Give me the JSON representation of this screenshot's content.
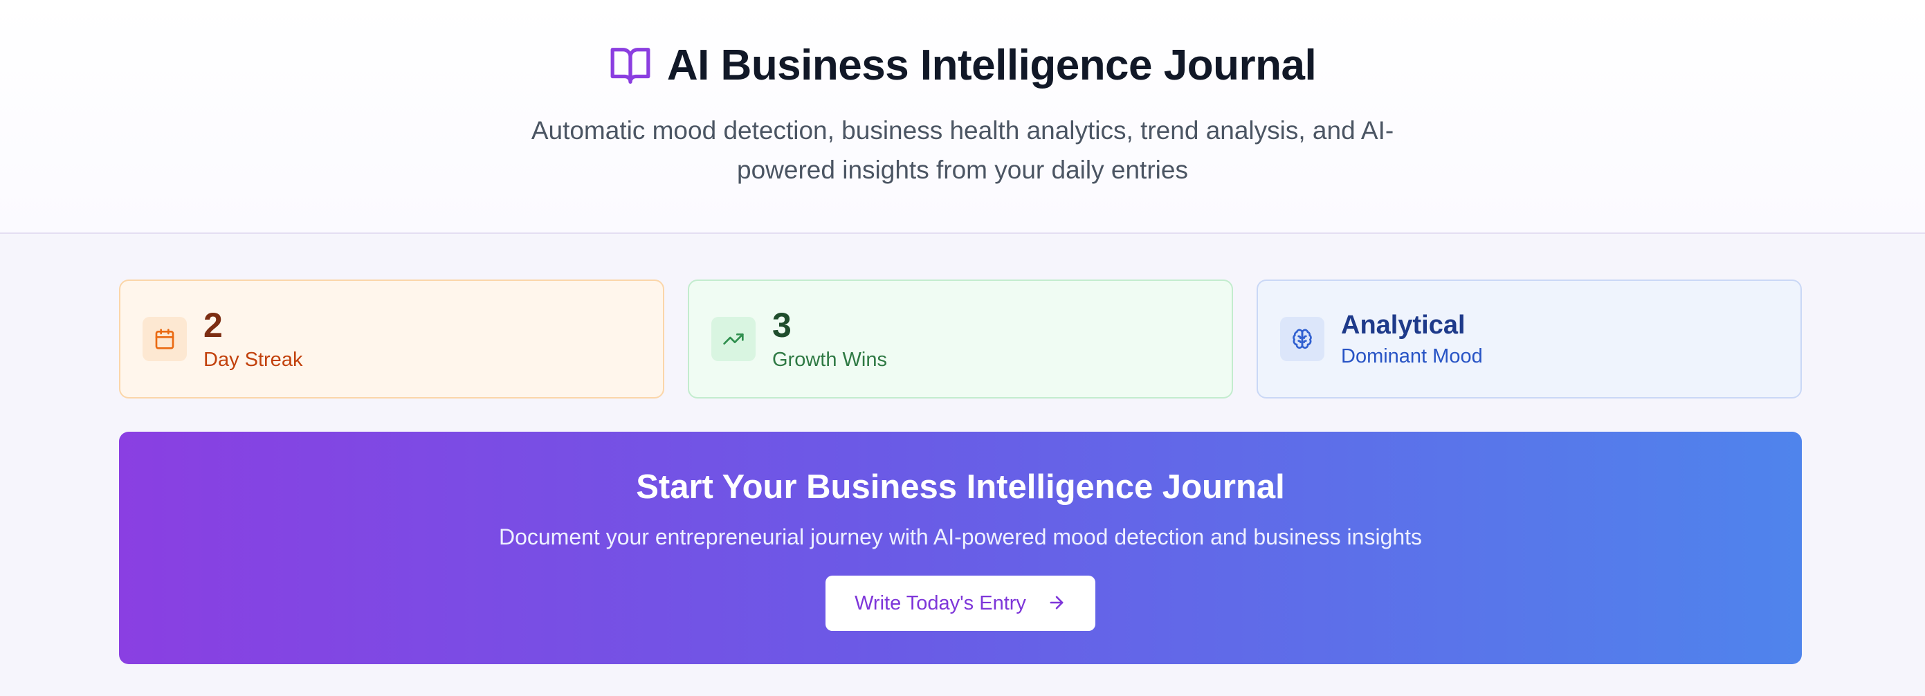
{
  "header": {
    "title": "AI Business Intelligence Journal",
    "title_icon": "open-book-icon",
    "subtitle": "Automatic mood detection, business health analytics, trend analysis, and AI-powered insights from your daily entries"
  },
  "stats": [
    {
      "value": "2",
      "label": "Day Streak",
      "icon": "calendar-icon",
      "theme": "orange"
    },
    {
      "value": "3",
      "label": "Growth Wins",
      "icon": "trending-up-icon",
      "theme": "green"
    },
    {
      "value": "Analytical",
      "label": "Dominant Mood",
      "icon": "brain-icon",
      "theme": "blue"
    }
  ],
  "cta": {
    "title": "Start Your Business Intelligence Journal",
    "description": "Document your entrepreneurial journey with AI-powered mood detection and business insights",
    "button_label": "Write Today's Entry",
    "button_icon": "arrow-right-icon"
  },
  "colors": {
    "accent_purple": "#7e36d9",
    "gradient_start": "#8a3fe2",
    "gradient_end": "#4f84ec",
    "streak_orange": "#c2410c",
    "growth_green": "#2f7a44",
    "mood_blue": "#2854c5"
  }
}
